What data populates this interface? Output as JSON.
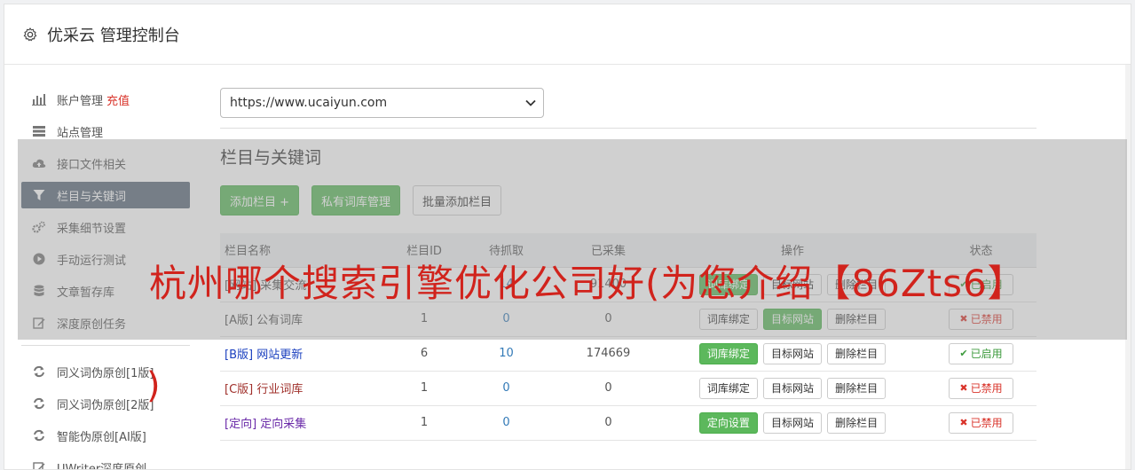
{
  "header": {
    "title": "优采云 管理控制台"
  },
  "sidebar": {
    "items": [
      {
        "label": "账户管理",
        "extra": "充值",
        "icon": "bar-chart-icon"
      },
      {
        "label": "站点管理",
        "icon": "server-icon"
      },
      {
        "label": "接口文件相关",
        "icon": "cloud-upload-icon"
      },
      {
        "label": "栏目与关键词",
        "icon": "filter-icon",
        "active": true
      },
      {
        "label": "采集细节设置",
        "icon": "gears-icon"
      },
      {
        "label": "手动运行测试",
        "icon": "play-circle-icon"
      },
      {
        "label": "文章暂存库",
        "icon": "database-icon"
      },
      {
        "label": "深度原创任务",
        "icon": "edit-icon"
      }
    ],
    "items2": [
      {
        "label": "同义词伪原创[1版]",
        "icon": "refresh-icon"
      },
      {
        "label": "同义词伪原创[2版]",
        "icon": "refresh-icon"
      },
      {
        "label": "智能伪原创[AI版]",
        "icon": "refresh-icon"
      },
      {
        "label": "UWriter深度原创",
        "icon": "edit-icon"
      }
    ]
  },
  "site_select": {
    "value": "https://www.ucaiyun.com"
  },
  "section": {
    "title": "栏目与关键词",
    "buttons": {
      "add": "添加栏目 +",
      "private_lib": "私有词库管理",
      "batch_add": "批量添加栏目"
    }
  },
  "table": {
    "headers": {
      "name": "栏目名称",
      "id": "栏目ID",
      "pending": "待抓取",
      "collected": "已采集",
      "ops": "操作",
      "status": "状态"
    },
    "rows": [
      {
        "name": "[网站] 采集交流",
        "id": "",
        "pending": "14",
        "collected": "91400",
        "op1": "词库绑定",
        "op1_green": true,
        "op2": "目标网站",
        "op3": "删除栏目",
        "status": "已启用",
        "on": true
      },
      {
        "name": "[A版] 公有词库",
        "id": "1",
        "pending": "0",
        "collected": "0",
        "op1": "词库绑定",
        "op1_green": false,
        "op2": "目标网站",
        "op2_green": true,
        "op3": "删除栏目",
        "status": "已禁用",
        "on": false
      },
      {
        "name": "[B版] 网站更新",
        "id": "6",
        "pending": "10",
        "collected": "174669",
        "op1": "词库绑定",
        "op1_green": true,
        "op2": "目标网站",
        "op3": "删除栏目",
        "status": "已启用",
        "on": true,
        "color": "#1a3fbf"
      },
      {
        "name": "[C版] 行业词库",
        "id": "1",
        "pending": "0",
        "collected": "0",
        "op1": "词库绑定",
        "op1_green": false,
        "op2": "目标网站",
        "op3": "删除栏目",
        "status": "已禁用",
        "on": false,
        "color": "#a0302b"
      },
      {
        "name": "[定向] 定向采集",
        "id": "1",
        "pending": "0",
        "collected": "0",
        "op1": "定向设置",
        "op1_green": true,
        "op2": "目标网站",
        "op3": "删除栏目",
        "status": "已禁用",
        "on": false,
        "color": "#6a2aa8"
      }
    ]
  },
  "watermark": {
    "text": "杭州哪个搜索引擎优化公司好(为您介绍【86Zts6】",
    "tail": ")"
  },
  "colors": {
    "accent_green": "#5cb85c",
    "active_nav": "#5b6b7a",
    "danger": "#d9342b",
    "link": "#337ab7"
  }
}
